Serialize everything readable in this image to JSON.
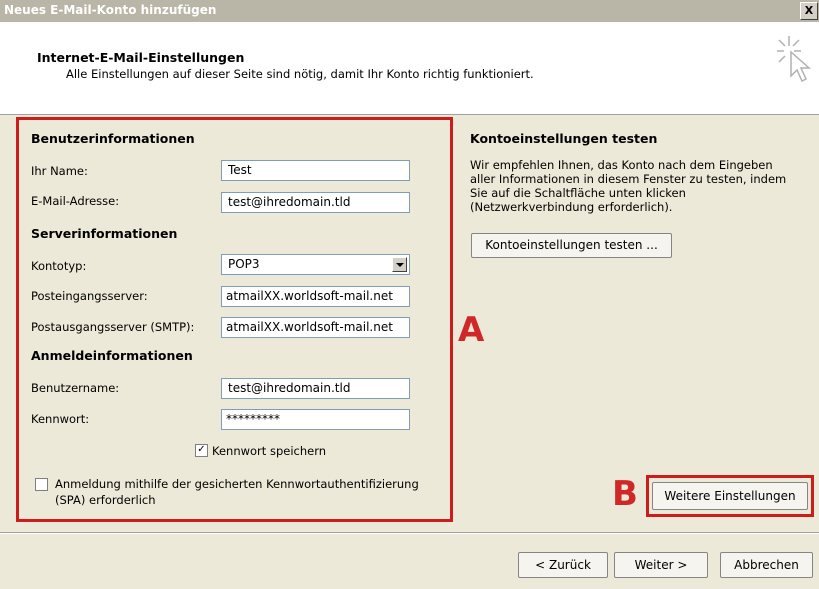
{
  "window": {
    "title": "Neues E-Mail-Konto hinzufügen",
    "close_label": "X"
  },
  "header": {
    "title": "Internet-E-Mail-Einstellungen",
    "subtitle": "Alle Einstellungen auf dieser Seite sind nötig, damit Ihr Konto richtig funktioniert."
  },
  "user_info": {
    "heading": "Benutzerinformationen",
    "name_label": "Ihr Name:",
    "name_value": "Test",
    "email_label": "E-Mail-Adresse:",
    "email_value": "test@ihredomain.tld"
  },
  "server_info": {
    "heading": "Serverinformationen",
    "account_type_label": "Kontotyp:",
    "account_type_value": "POP3",
    "incoming_label": "Posteingangsserver:",
    "incoming_value": "atmailXX.worldsoft-mail.net",
    "outgoing_label": "Postausgangsserver (SMTP):",
    "outgoing_value": "atmailXX.worldsoft-mail.net"
  },
  "login_info": {
    "heading": "Anmeldeinformationen",
    "username_label": "Benutzername:",
    "username_value": "test@ihredomain.tld",
    "password_label": "Kennwort:",
    "password_value": "*********",
    "remember_label": "Kennwort speichern",
    "remember_checked": true,
    "spa_label_line1": "Anmeldung mithilfe der gesicherten Kennwortauthentifizierung",
    "spa_label_line2": "(SPA) erforderlich",
    "spa_checked": false
  },
  "test_settings": {
    "heading": "Kontoeinstellungen testen",
    "description": [
      "Wir empfehlen Ihnen, das Konto nach dem Eingeben",
      "aller Informationen in diesem Fenster zu testen, indem",
      "Sie auf die Schaltfläche unten klicken",
      "(Netzwerkverbindung erforderlich)."
    ],
    "test_button": "Kontoeinstellungen testen ..."
  },
  "more_settings_button": "Weitere Einstellungen",
  "annotations": {
    "a": "A",
    "b": "B",
    "color": "#cc1c1c"
  },
  "footer": {
    "back": "< Zurück",
    "next": "Weiter >",
    "cancel": "Abbrechen"
  }
}
